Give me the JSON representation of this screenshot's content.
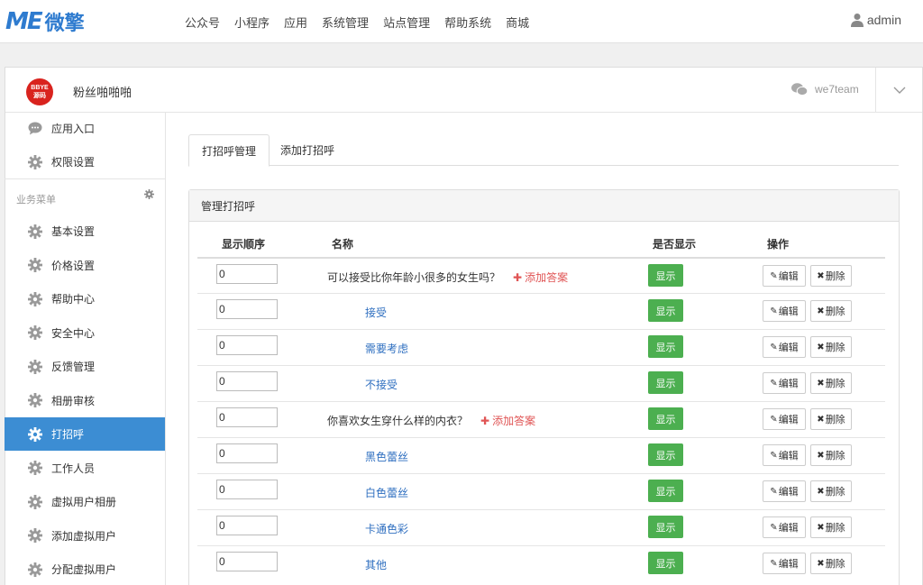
{
  "brand": {
    "logo_latin": "ME",
    "logo_cn": "微擎"
  },
  "nav": {
    "items": [
      "公众号",
      "小程序",
      "应用",
      "系统管理",
      "站点管理",
      "帮助系统",
      "商城"
    ],
    "user": "admin"
  },
  "account": {
    "logo_text_1": "BBYE",
    "logo_text_2": "源码",
    "name": "粉丝啪啪啪",
    "wechat_id": "we7team"
  },
  "sidebar": {
    "top_items": [
      {
        "label": "应用入口",
        "icon": "chat-icon"
      },
      {
        "label": "权限设置",
        "icon": "gear-icon"
      }
    ],
    "group_title": "业务菜单",
    "items": [
      {
        "label": "基本设置"
      },
      {
        "label": "价格设置"
      },
      {
        "label": "帮助中心"
      },
      {
        "label": "安全中心"
      },
      {
        "label": "反馈管理"
      },
      {
        "label": "相册审核"
      },
      {
        "label": "打招呼",
        "active": true
      },
      {
        "label": "工作人员"
      },
      {
        "label": "虚拟用户相册"
      },
      {
        "label": "添加虚拟用户"
      },
      {
        "label": "分配虚拟用户"
      }
    ]
  },
  "tabs": [
    "打招呼管理",
    "添加打招呼"
  ],
  "box_title": "管理打招呼",
  "table": {
    "headers": [
      "显示顺序",
      "名称",
      "是否显示",
      "操作"
    ],
    "show_label": "显示",
    "edit_label": "编辑",
    "delete_label": "删除",
    "add_answer_label": "添加答案",
    "rows": [
      {
        "order": "0",
        "name": "可以接受比你年龄小很多的女生吗？",
        "question": true
      },
      {
        "order": "0",
        "name": "接受",
        "question": false
      },
      {
        "order": "0",
        "name": "需要考虑",
        "question": false
      },
      {
        "order": "0",
        "name": "不接受",
        "question": false
      },
      {
        "order": "0",
        "name": "你喜欢女生穿什么样的内衣？",
        "question": true
      },
      {
        "order": "0",
        "name": "黑色蕾丝",
        "question": false
      },
      {
        "order": "0",
        "name": "白色蕾丝",
        "question": false
      },
      {
        "order": "0",
        "name": "卡通色彩",
        "question": false
      },
      {
        "order": "0",
        "name": "其他",
        "question": false
      }
    ]
  },
  "colors": {
    "accent": "#3c8dd3",
    "show_green": "#4caf50",
    "add_red": "#e05555",
    "link_blue": "#2f6fc0"
  }
}
